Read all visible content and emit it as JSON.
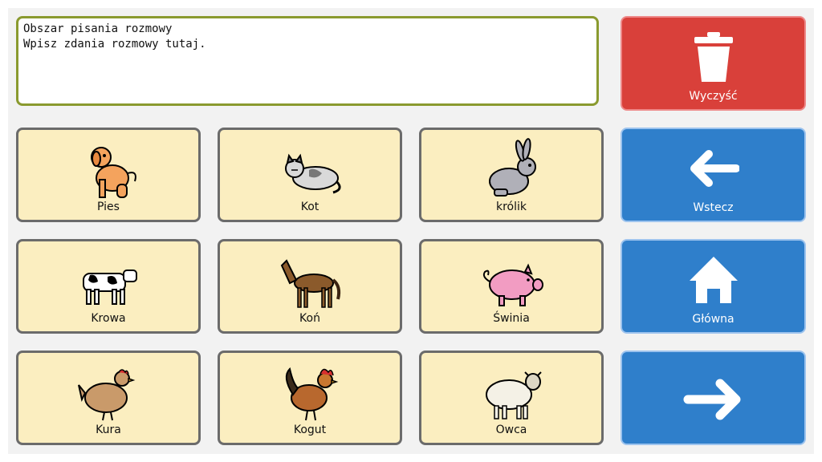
{
  "message_box": {
    "title": "Obszar pisania rozmowy",
    "placeholder_text": "Wpisz zdania rozmowy tutaj."
  },
  "tiles": [
    {
      "label": "Pies",
      "icon": "dog-icon"
    },
    {
      "label": "Kot",
      "icon": "cat-icon"
    },
    {
      "label": "królik",
      "icon": "rabbit-icon"
    },
    {
      "label": "Krowa",
      "icon": "cow-icon"
    },
    {
      "label": "Koń",
      "icon": "horse-icon"
    },
    {
      "label": "Świnia",
      "icon": "pig-icon"
    },
    {
      "label": "Kura",
      "icon": "hen-icon"
    },
    {
      "label": "Kogut",
      "icon": "rooster-icon"
    },
    {
      "label": "Owca",
      "icon": "sheep-icon"
    }
  ],
  "controls": {
    "clear": {
      "label": "Wyczyść",
      "icon": "trash-icon"
    },
    "back": {
      "label": "Wstecz",
      "icon": "arrow-left-icon"
    },
    "home": {
      "label": "Główna",
      "icon": "home-icon"
    },
    "next": {
      "label": "",
      "icon": "arrow-right-icon"
    }
  },
  "colors": {
    "tile_bg": "#fbeec0",
    "clear_bg": "#d9403a",
    "nav_bg": "#2f7fcb",
    "text_border": "#8a9a2f"
  }
}
